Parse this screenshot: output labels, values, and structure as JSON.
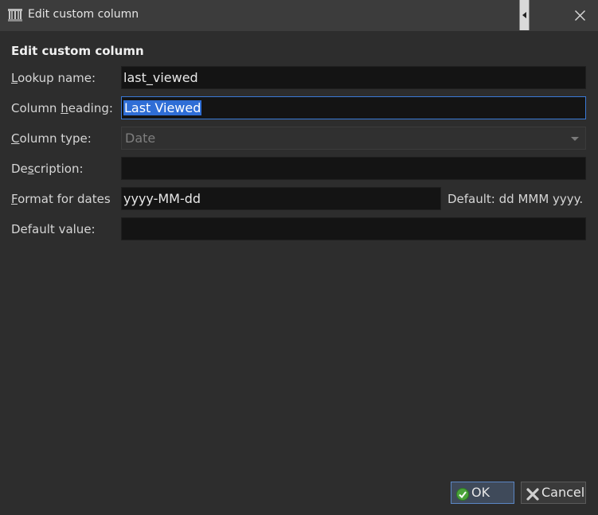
{
  "window": {
    "title": "Edit custom column",
    "icon": "library-icon",
    "close_icon": "close-icon"
  },
  "dialog": {
    "heading": "Edit custom column"
  },
  "fields": {
    "lookup_name": {
      "label_u": "L",
      "label_rest": "ookup name:",
      "value": "last_viewed"
    },
    "column_heading": {
      "label_pre": "Column ",
      "label_u": "h",
      "label_rest": "eading:",
      "value": "Last Viewed"
    },
    "column_type": {
      "label_u": "C",
      "label_rest": "olumn type:",
      "value": "Date"
    },
    "description": {
      "label_pre": "De",
      "label_u": "s",
      "label_rest": "cription:",
      "value": ""
    },
    "format_dates": {
      "label_u": "F",
      "label_rest": "ormat for dates",
      "value": "yyyy-MM-dd",
      "hint": "Default: dd MMM yyyy."
    },
    "default_value": {
      "label": "Default value:",
      "value": ""
    }
  },
  "buttons": {
    "ok": "OK",
    "cancel": "Cancel"
  },
  "colors": {
    "accent": "#2f6ed6",
    "background": "#2d2d2d",
    "field_bg": "#141414"
  }
}
